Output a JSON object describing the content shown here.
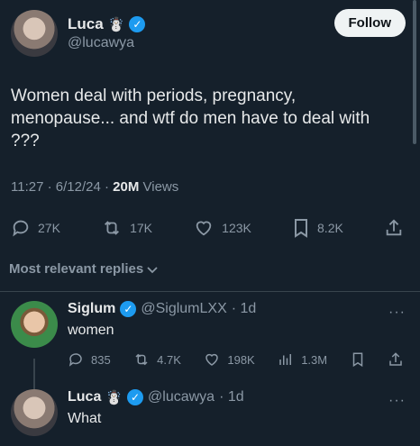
{
  "post": {
    "author_name": "Luca",
    "author_badge_emoji": "☃️",
    "author_handle": "@lucawya",
    "follow_label": "Follow",
    "text": "Women deal with periods, pregnancy, menopause... and wtf do men have to deal with ???",
    "time": "11:27 · 6/12/24 · ",
    "views_count": "20M",
    "views_label": "Views",
    "replies": "27K",
    "reposts": "17K",
    "likes": "123K",
    "bookmarks": "8.2K"
  },
  "sort": {
    "label": "Most relevant replies"
  },
  "replies": [
    {
      "name": "Siglum",
      "handle": "@SiglumLXX",
      "age": "· 1d",
      "text": "women",
      "replies": "835",
      "reposts": "4.7K",
      "likes": "198K",
      "views": "1.3M"
    },
    {
      "name": "Luca",
      "badge_emoji": "☃️",
      "handle": "@lucawya",
      "age": "· 1d",
      "text": "What"
    }
  ],
  "colors": {
    "background": "#15202b",
    "verified": "#1d9bf0",
    "muted": "#8b98a5"
  }
}
